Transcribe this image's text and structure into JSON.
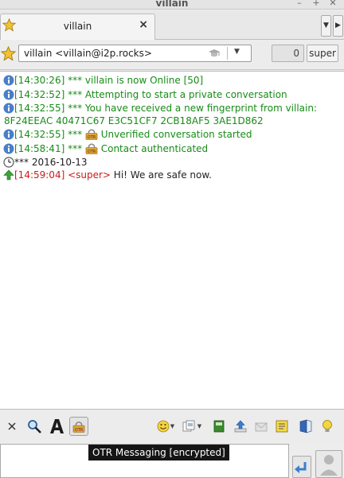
{
  "window": {
    "title": "villain"
  },
  "tabs": [
    {
      "label": "villain",
      "close_glyph": "×"
    }
  ],
  "contact": {
    "combo_text": "villain <villain@i2p.rocks>",
    "unread_count": "0",
    "my_status": "super"
  },
  "log": {
    "lines": [
      {
        "time": "[14:30:26]",
        "text": " *** villain is now Online [50]"
      },
      {
        "time": "[14:32:52]",
        "text": " *** Attempting to start a private conversation"
      },
      {
        "time": "[14:32:55]",
        "text": " *** You have received a new fingerprint from villain:",
        "cont": "8F24EEAC 40471C67 E3C51CF7 2CB18AF5 3AE1D862"
      },
      {
        "time": "[14:32:55]",
        "pre": " *** ",
        "text": " Unverified conversation started"
      },
      {
        "time": "[14:58:41]",
        "pre": " *** ",
        "text": " Contact authenticated"
      },
      {
        "text": "*** 2016-10-13"
      },
      {
        "time": "[14:59:04]",
        "nick": " <super>",
        "text": " Hi! We are safe now."
      }
    ]
  },
  "otr": {
    "badge": "OTR"
  },
  "composer": {
    "tooltip": "OTR Messaging [encrypted]"
  },
  "colors": {
    "system": "#178c17",
    "own_message": "#d01818",
    "info_icon": "#4a7fc8",
    "otr_accent": "#d9a63a"
  }
}
